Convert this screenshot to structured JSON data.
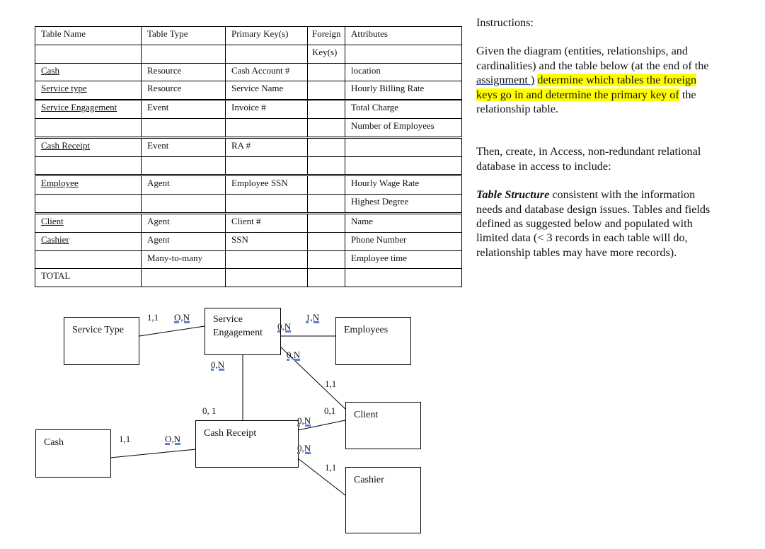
{
  "table": {
    "headers": [
      "Table Name",
      "Table Type",
      "Primary Key(s)",
      "Foreign",
      "Attributes"
    ],
    "header_row2": [
      "",
      "",
      "",
      "Key(s)",
      ""
    ],
    "rows": [
      {
        "name": "Cash",
        "type": "Resource",
        "pk": "Cash Account #",
        "fk": "",
        "attr": "location"
      },
      {
        "name": "Service type",
        "type": "Resource",
        "pk": "Service Name",
        "fk": "",
        "attr": "Hourly Billing Rate"
      },
      {
        "name": "Service Engagement",
        "type": "Event",
        "pk": "Invoice #",
        "fk": "",
        "attr": "Total Charge"
      },
      {
        "name": "",
        "type": "",
        "pk": "",
        "fk": "",
        "attr": "Number of Employees"
      },
      {
        "name": "Cash Receipt",
        "type": "Event",
        "pk": "RA #",
        "fk": "",
        "attr": ""
      },
      {
        "name": "",
        "type": "",
        "pk": "",
        "fk": "",
        "attr": ""
      },
      {
        "name": "Employee",
        "type": "Agent",
        "pk": "Employee SSN",
        "fk": "",
        "attr": "Hourly Wage Rate"
      },
      {
        "name": "",
        "type": "",
        "pk": "",
        "fk": "",
        "attr": "Highest Degree"
      },
      {
        "name": "Client",
        "type": "Agent",
        "pk": "Client #",
        "fk": "",
        "attr": "Name"
      },
      {
        "name": "Cashier",
        "type": "Agent",
        "pk": "SSN",
        "fk": "",
        "attr": "Phone Number"
      },
      {
        "name": "",
        "type": "Many-to-many",
        "pk": "",
        "fk": "",
        "attr": "Employee time"
      },
      {
        "name": "TOTAL",
        "type": "",
        "pk": "",
        "fk": "",
        "attr": ""
      }
    ]
  },
  "instructions": {
    "heading": "Instructions:",
    "p1_a": "Given the diagram (entities, relationships, and cardinalities) and the table below (at the end of the ",
    "p1_link": "assignment )",
    "p1_b": " ",
    "p1_highlight": "determine which tables the foreign keys go in and determine the primary key of",
    "p1_c": " the relationship table.",
    "p2": "Then, create, in Access, non-redundant relational database in access to include:",
    "p3_bold": "Table Structure",
    "p3_rest": " consistent with the information needs and database design issues. Tables and fields defined as suggested below and populated with limited data (< 3 records in each table will do, relationship tables may have more records).",
    "highlight_color": "#ffff00"
  },
  "diagram": {
    "entities": {
      "service_type": "Service Type",
      "service_engagement_1": "Service",
      "service_engagement_2": "Engagement",
      "employees": "Employees",
      "cash": "Cash",
      "cash_receipt": "Cash Receipt",
      "client": "Client",
      "cashier": "Cashier"
    },
    "cardinalities": {
      "st_side": "1,1",
      "se_st_side": "O,N",
      "se_emp_side": "0,N",
      "emp_side": "1,N",
      "se_client_side": "0,N",
      "se_cr_side": "0,N",
      "client_se_side": "1,1",
      "cr_se_side": "0, 1",
      "client_cr_side": "0,1",
      "cr_client_side": "0,N",
      "cash_side": "1,1",
      "cr_cash_side": "O,N",
      "cr_cashier_side": "0,N",
      "cashier_side": "1,1"
    }
  }
}
